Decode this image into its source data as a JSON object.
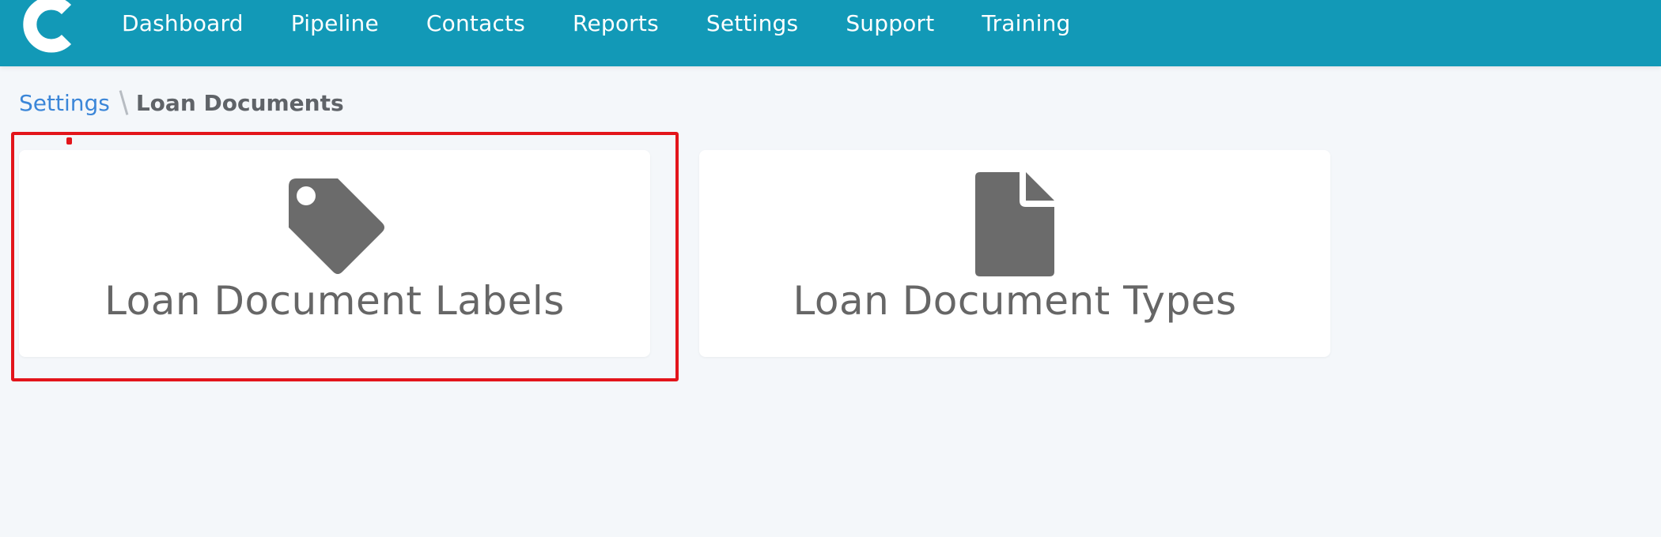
{
  "header": {
    "logo_icon": "c-logo-icon",
    "background_color": "#1299b7",
    "nav": [
      {
        "label": "Dashboard"
      },
      {
        "label": "Pipeline"
      },
      {
        "label": "Contacts"
      },
      {
        "label": "Reports"
      },
      {
        "label": "Settings"
      },
      {
        "label": "Support"
      },
      {
        "label": "Training"
      }
    ]
  },
  "breadcrumb": {
    "parent": "Settings",
    "current": "Loan Documents"
  },
  "cards": [
    {
      "title": "Loan Document Labels",
      "icon": "tag-icon",
      "highlighted": true
    },
    {
      "title": "Loan Document Types",
      "icon": "file-icon",
      "highlighted": false
    }
  ],
  "colors": {
    "accent": "#1299b7",
    "link": "#3b86d8",
    "icon": "#6b6b6b",
    "text": "#666666",
    "highlight": "#e3151b",
    "page_background": "#f4f7fa"
  }
}
